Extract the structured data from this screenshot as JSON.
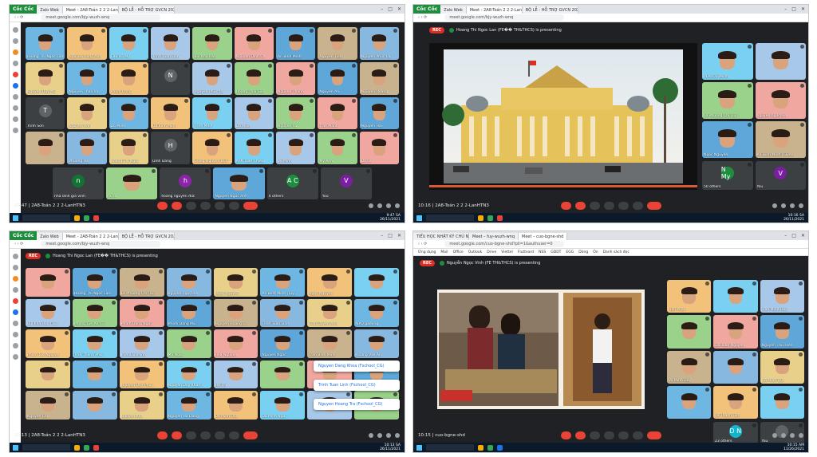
{
  "panels": [
    {
      "tabs": [
        "Zalo Web",
        "Meet - 2A8-Toán 2 2 2-LanHTN3",
        "BỘ LỄ - HỖ TRỢ GVCN 2021"
      ],
      "brand": "Cốc Cốc",
      "url": "meet.google.com/bjy-wuzh-wnq",
      "time": "09:47",
      "meeting": "2A8-Toán 2 2 2-LanHTN3",
      "clock": [
        "9:47 SA",
        "26/11/2021"
      ],
      "tiles": [
        "Hoang Thi Ngoc Lan",
        "Nguyen Hong Anh",
        "Cao Ha My",
        "Trinh Tuan Linh",
        "Bui Kha Han",
        "Nguyen Dinh Ch",
        "An Binh Minh",
        "Nguyen Tien",
        "Nguyen Phuc La",
        "Nguyen Duy Ma",
        "Nguyen Thao Vy",
        "Pham Dang",
        "",
        "Nguyen Phuc La",
        "Hoang Thai Son",
        "Nguyen Thanh",
        "Nguyen An",
        "Nguyen Hoang",
        "Trinh Son",
        "Nguyen Anh",
        "Do Minh",
        "Do Binh Minh",
        "Trinh Minh",
        "Do Minh",
        "Nguyen Vu",
        "Tran Manh",
        "Nguyen Hai",
        "",
        "Phuong Ha",
        "Hoang Thi Ngoc",
        "Dinh Dang",
        "Giang Nguyen BSC",
        "Anh Tuan Chieu",
        "Vu Minh",
        "My Anh",
        "Do Le"
      ],
      "tile_letters": {
        "12": "N",
        "18": "T",
        "30": "H"
      },
      "bottom_row": [
        {
          "name": "nhà lãnh gia vinh",
          "letter": "n",
          "color": "#137333"
        },
        {
          "name": "nu lo",
          "letter": "",
          "color": ""
        },
        {
          "name": "hoàng nguyên đức",
          "letter": "h",
          "color": "#8e24aa"
        },
        {
          "name": "Nguyen Ngoc Anh",
          "letter": "",
          "color": ""
        },
        {
          "name": "4 others",
          "letter": "A C",
          "color": "#1e8e3e"
        },
        {
          "name": "You",
          "letter": "V",
          "color": "#7b1fa2"
        }
      ]
    },
    {
      "tabs": [
        "Zalo Web",
        "Meet - 2A8-Toán 2 2 2-LanHTN3",
        "BỘ LỄ - HỖ TRỢ GVCN 2021"
      ],
      "brand": "Cốc Cốc",
      "url": "meet.google.com/bjy-wuzh-wnq",
      "rec": "REC",
      "presenting": "Hoang Thi Ngoc Lan (FE�� TH&THCS) is presenting",
      "time": "10:16",
      "meeting": "2A8-Toán 2 2 2-LanHTN3",
      "clock": [
        "10:16 SA",
        "26/11/2021"
      ],
      "side_tiles": [
        "PLAnDuyMinh",
        "",
        "Le Phuong Chi (Tu...",
        "nguyen ngocnnn",
        "Ngoc Nguyen",
        "An Binh Minh (Tuyên"
      ],
      "side_bottom": [
        {
          "name": "50 others",
          "letter": "N My"
        },
        {
          "name": "You",
          "letter": "V"
        }
      ]
    },
    {
      "tabs": [
        "Zalo Web",
        "Meet - 2A8-Toán 2 2 2-LanHTN3",
        "BỘ LỄ - HỖ TRỢ GVCN 2021"
      ],
      "brand": "Cốc Cốc",
      "url": "meet.google.com/bjy-wuzh-wnq",
      "rec": "REC",
      "presenting": "Hoang Thi Ngoc Lan (FE�� TH&THCS) is presenting",
      "time": "10:13",
      "meeting": "2A8-Toán 2 2 2-LanHTN3",
      "clock": [
        "10:13 SA",
        "26/11/2021"
      ],
      "tiles": [
        "",
        "Hoang Thi Ngoc Lan",
        "Le Phuong Chi (Tu...",
        "nguyen ngocnnn",
        "Ngoc Nguyen",
        "An Binh Minh (Tuy...",
        "Ngoc Nguyen",
        "",
        "Bui Kha Han (Tu...",
        "Phong Tue An (T...",
        "Pham Dang Ngu...",
        "Pham Dang Ma...",
        "Nguyen Hoang L...",
        "Trinh Tuan Linh",
        "Tran Duyen Anh",
        "NPD gaming",
        "Pham Tue Nguyen",
        "Tran Thanh Phu...",
        "PLAnDuyMinh",
        "My Ngoc",
        "Hoa Nguyen",
        "Nguyen Ngoc",
        "Tran Binh Minh",
        "Hoang Van An",
        "",
        "",
        "Nguyen Duy Phu...",
        "Nguyen Duy Khan...",
        "Ha Thi",
        "",
        "",
        "",
        "Nguyen Chi",
        "",
        "Nguyen Anh",
        "Nguyen Ha Dang",
        "Do Minh Duc",
        "Do Minh Ngu...",
        "",
        ""
      ],
      "toasts": [
        "Nguyen Dang Khoa (Fschool_CG)",
        "Trinh Tuan Linh (Fschool_CG)",
        "Nguyen Hoang Tra (Fschool_CG)"
      ]
    },
    {
      "tabs": [
        "TIỂU HỌC NHẬT KÝ CHỦ NHIỆM",
        "Meet – fuy-wuzh-wnq",
        "Meet – cuo-bgne-shd"
      ],
      "brand": "",
      "url": "meet.google.com/cuo-bgne-shd?pli=1&authuser=0",
      "bookmarks": [
        "Ứng dụng",
        "Mail",
        "Office",
        "Outlook",
        "Drive",
        "Viettel",
        "Flutteard",
        "NSS",
        "GDDT",
        "EGG",
        "Dòng",
        "Ôn",
        "Danh sách đọc"
      ],
      "rec": "REC",
      "presenting": "Nguyễn Ngọc Vinh (FE TH&THCS) is presenting",
      "time": "10:15",
      "meeting": "cuo-bgne-shd",
      "clock": [
        "10:15 AM",
        "11/26/2021"
      ],
      "side_tiles": [
        "Hân Phan",
        "",
        "Tran Minh Duc",
        "",
        "Do Toan Nguyen",
        "Nguyen Thu Hien",
        "Vo Minh Duy",
        "",
        "Do Minh Duc",
        "",
        "Le Thanh Tam",
        ""
      ],
      "side_bottom": [
        {
          "name": "23 others",
          "letter": "D N"
        },
        {
          "name": "You",
          "letter": ""
        }
      ]
    }
  ],
  "colors": {
    "meet_bg": "#202124",
    "tile_bg": "#3c4043",
    "end_call": "#ea4335",
    "rec": "#d93025"
  }
}
